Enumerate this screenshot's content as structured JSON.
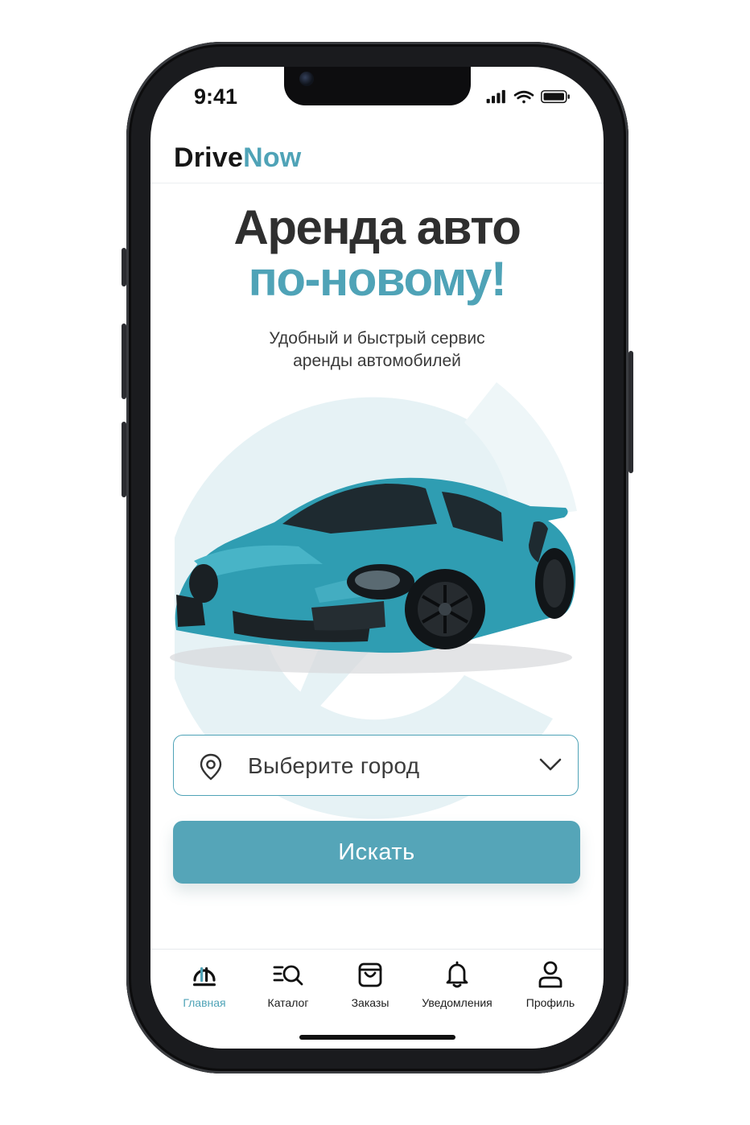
{
  "status_bar": {
    "time": "9:41",
    "icons": [
      "signal-icon",
      "wifi-icon",
      "battery-icon"
    ]
  },
  "header": {
    "brand_part1": "Drive",
    "brand_part2": "Now"
  },
  "hero": {
    "title_line1": "Аренда авто",
    "title_line2": "по-новому!",
    "subtitle_line1": "Удобный и быстрый сервис",
    "subtitle_line2": "аренды автомобилей"
  },
  "city_select": {
    "placeholder": "Выберите город",
    "icon": "location-pin-icon"
  },
  "search_button": {
    "label": "Искать"
  },
  "tabbar": {
    "items": [
      {
        "label": "Главная",
        "icon": "home-icon",
        "active": true
      },
      {
        "label": "Каталог",
        "icon": "catalog-search-icon",
        "active": false
      },
      {
        "label": "Заказы",
        "icon": "shopping-bag-icon",
        "active": false
      },
      {
        "label": "Уведомления",
        "icon": "bell-icon",
        "active": false
      },
      {
        "label": "Профиль",
        "icon": "user-icon",
        "active": false
      }
    ]
  },
  "colors": {
    "accent": "#4fa3b7",
    "button": "#55a5b8",
    "car": "#2f9db2",
    "emblem": "#e4f1f4",
    "text_dark": "#2f2f2f"
  }
}
